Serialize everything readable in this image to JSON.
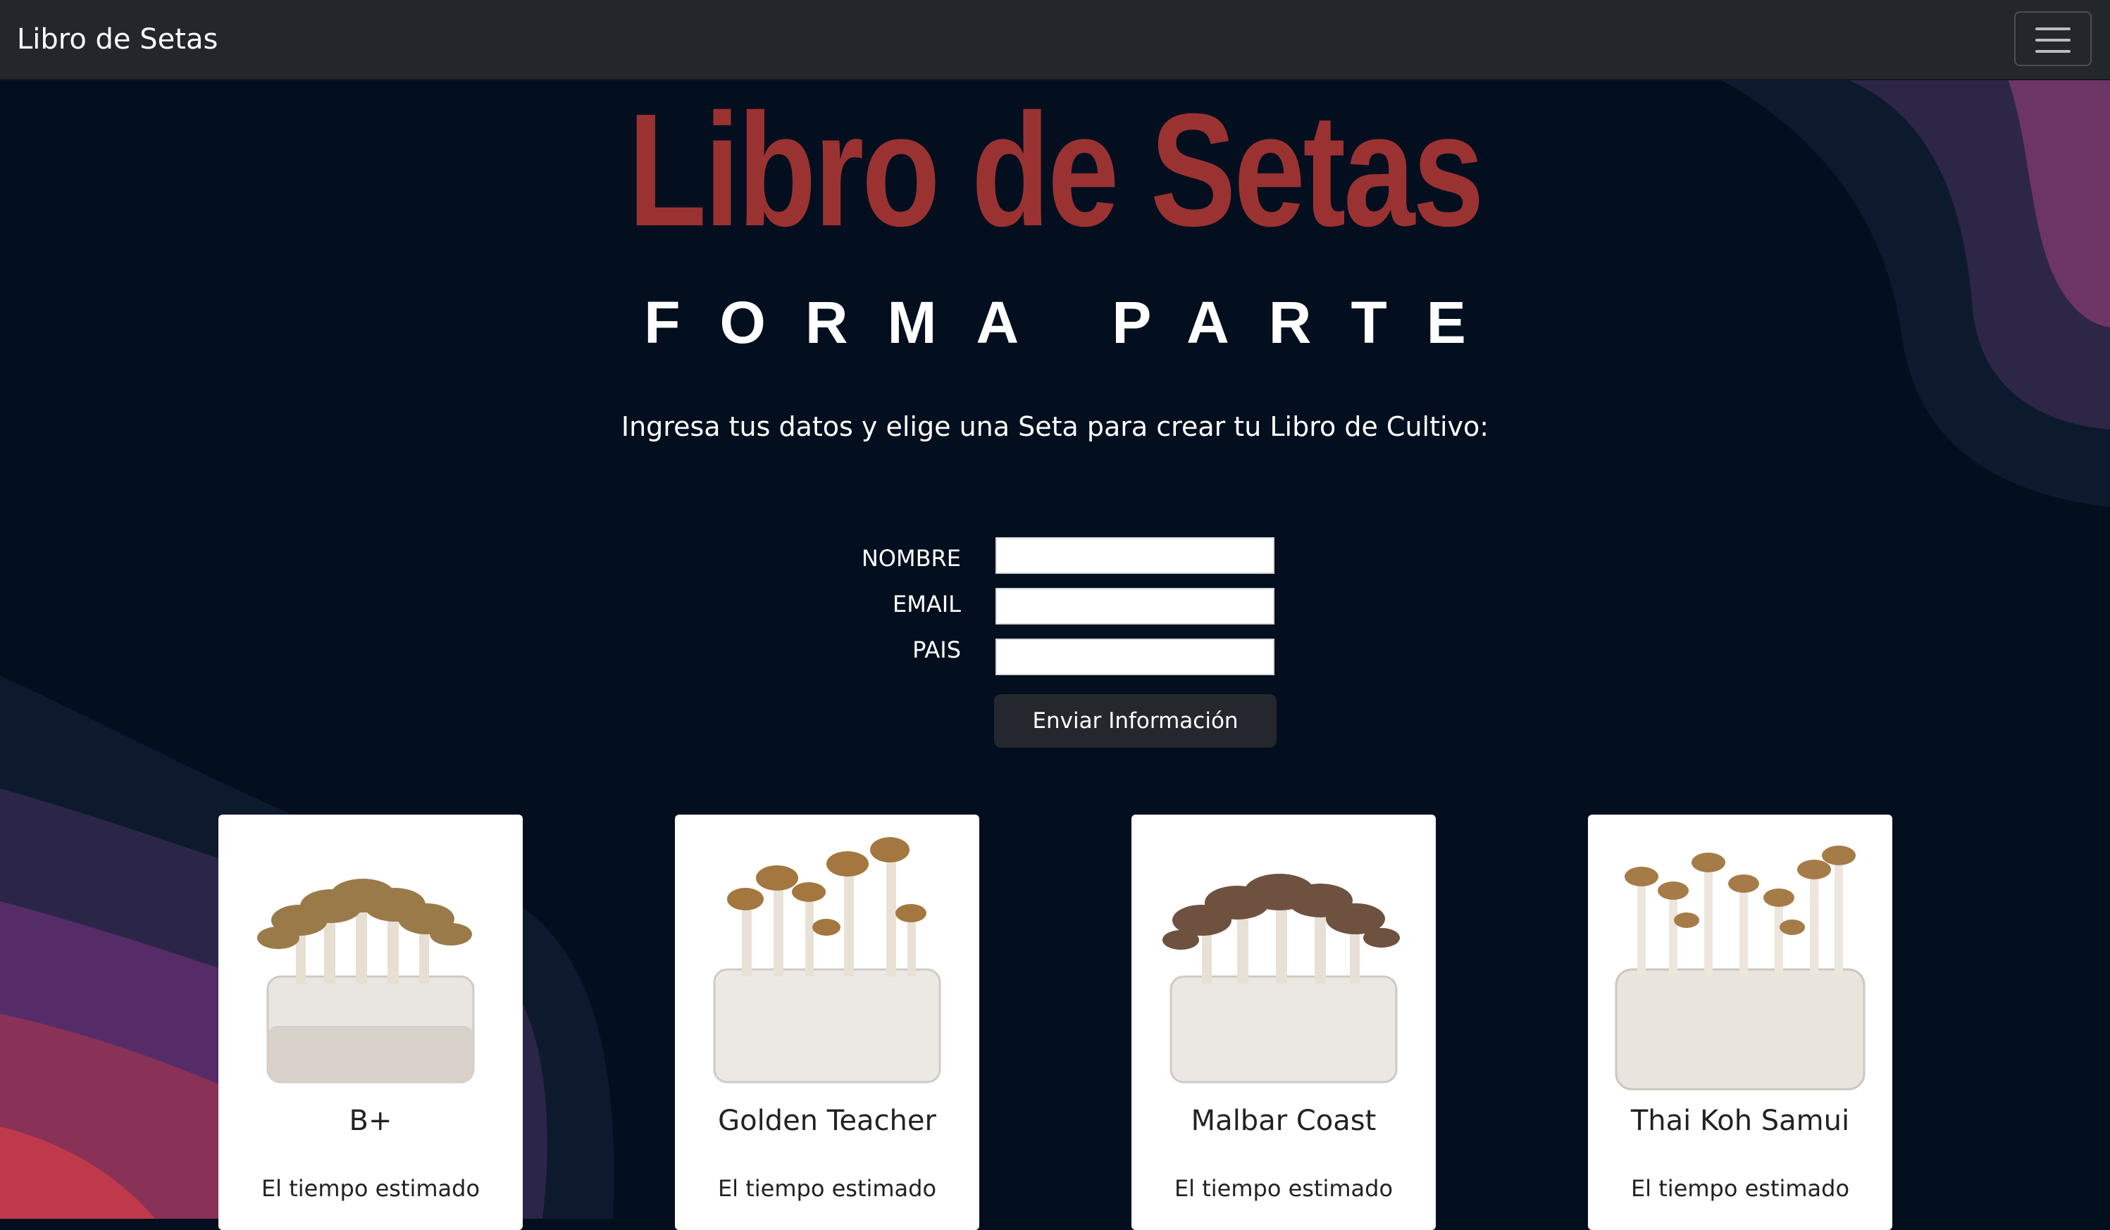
{
  "navbar": {
    "brand": "Libro de Setas",
    "menu_icon": "hamburger-menu-icon"
  },
  "hero": {
    "title": "Libro de Setas",
    "title_color": "#9b3232",
    "subtitle": "FORMA PARTE",
    "intro": "Ingresa tus datos y elige una Seta para crear tu Libro de Cultivo:"
  },
  "form": {
    "name_label": "NOMBRE",
    "email_label": "EMAIL",
    "country_label": "PAIS",
    "name_value": "",
    "email_value": "",
    "country_value": "",
    "submit_label": "Enviar Información"
  },
  "cards": [
    {
      "name": "B+",
      "text": "El tiempo estimado",
      "image": "mushroom-grow-kit-image"
    },
    {
      "name": "Golden Teacher",
      "text": "El tiempo estimado",
      "image": "mushroom-grow-kit-image"
    },
    {
      "name": "Malbar Coast",
      "text": "El tiempo estimado",
      "image": "mushroom-grow-kit-image"
    },
    {
      "name": "Thai Koh Samui",
      "text": "El tiempo estimado",
      "image": "mushroom-grow-kit-image"
    }
  ],
  "colors": {
    "background": "#030f1e",
    "navbar": "#23262b",
    "button": "#24272d",
    "wave_purple": "#5a2d6e",
    "wave_red": "#c0394a"
  }
}
